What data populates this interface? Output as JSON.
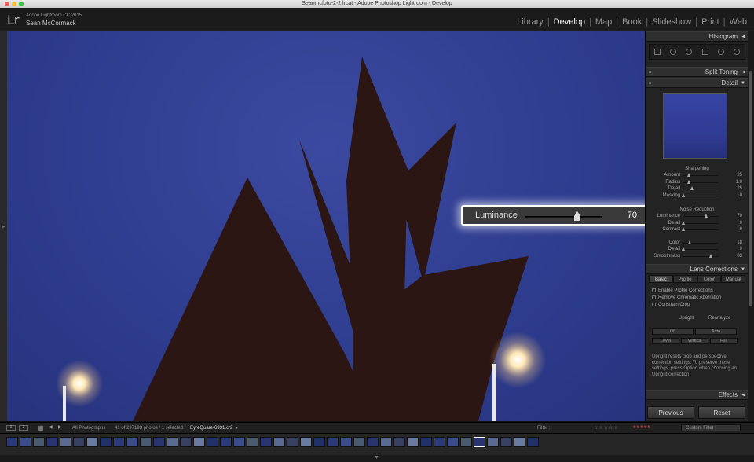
{
  "window": {
    "title": "Seanmcfoto-2-2.lrcat - Adobe Photoshop Lightroom - Develop"
  },
  "identity": {
    "logo": "Lr",
    "product": "Adobe Lightroom CC 2015",
    "user": "Sean McCormack"
  },
  "modules": [
    {
      "label": "Library"
    },
    {
      "label": "Develop",
      "active": true
    },
    {
      "label": "Map"
    },
    {
      "label": "Book"
    },
    {
      "label": "Slideshow"
    },
    {
      "label": "Print"
    },
    {
      "label": "Web"
    }
  ],
  "callout": {
    "label": "Luminance",
    "value": "70",
    "fraction": 0.7
  },
  "panels": {
    "histogram": "Histogram",
    "split_toning": "Split Toning",
    "detail": "Detail",
    "sharpening": {
      "title": "Sharpening",
      "rows": [
        {
          "label": "Amount",
          "value": "25",
          "fraction": 0.17
        },
        {
          "label": "Radius",
          "value": "1.0",
          "fraction": 0.17
        },
        {
          "label": "Detail",
          "value": "25",
          "fraction": 0.25
        },
        {
          "label": "Masking",
          "value": "0",
          "fraction": 0.0
        }
      ]
    },
    "noise_reduction": {
      "title": "Noise Reduction",
      "rows": [
        {
          "label": "Luminance",
          "value": "70",
          "fraction": 0.7
        },
        {
          "label": "Detail",
          "value": "0",
          "fraction": 0.0
        },
        {
          "label": "Contrast",
          "value": "0",
          "fraction": 0.0
        },
        {
          "label": "Color",
          "value": "18",
          "fraction": 0.18
        },
        {
          "label": "Detail",
          "value": "0",
          "fraction": 0.0
        },
        {
          "label": "Smoothness",
          "value": "83",
          "fraction": 0.83
        }
      ]
    },
    "lens_corrections": {
      "title": "Lens Corrections",
      "tabs": [
        "Basic",
        "Profile",
        "Color",
        "Manual"
      ],
      "checks": [
        "Enable Profile Corrections",
        "Remove Chromatic Aberration",
        "Constrain Crop"
      ],
      "upright": "Upright",
      "reanalyze": "Reanalyze",
      "buttons": [
        "Off",
        "Auto",
        "Level",
        "Vertical",
        "Full"
      ],
      "note": "Upright resets crop and perspective correction settings. To preserve these settings, press Option when choosing an Upright correction."
    },
    "effects": "Effects",
    "previous": "Previous",
    "reset": "Reset"
  },
  "toolbar": {
    "views": [
      "1",
      "2"
    ],
    "source": "All Photographs",
    "count": "41 of 297193 photos / 1 selected /",
    "file": "EyreQuare-6931.cr2",
    "filter_label": "Filter :",
    "custom_filter": "Custom Filter"
  },
  "colors": {
    "accent": "#ffffff",
    "panel": "#232323",
    "sky": "#2e3c8e",
    "sculpture": "#2b1614"
  },
  "icons": [
    "crop-overlay-icon",
    "spot-removal-icon",
    "red-eye-icon",
    "graduated-filter-icon",
    "radial-filter-icon",
    "adjustment-brush-icon"
  ]
}
